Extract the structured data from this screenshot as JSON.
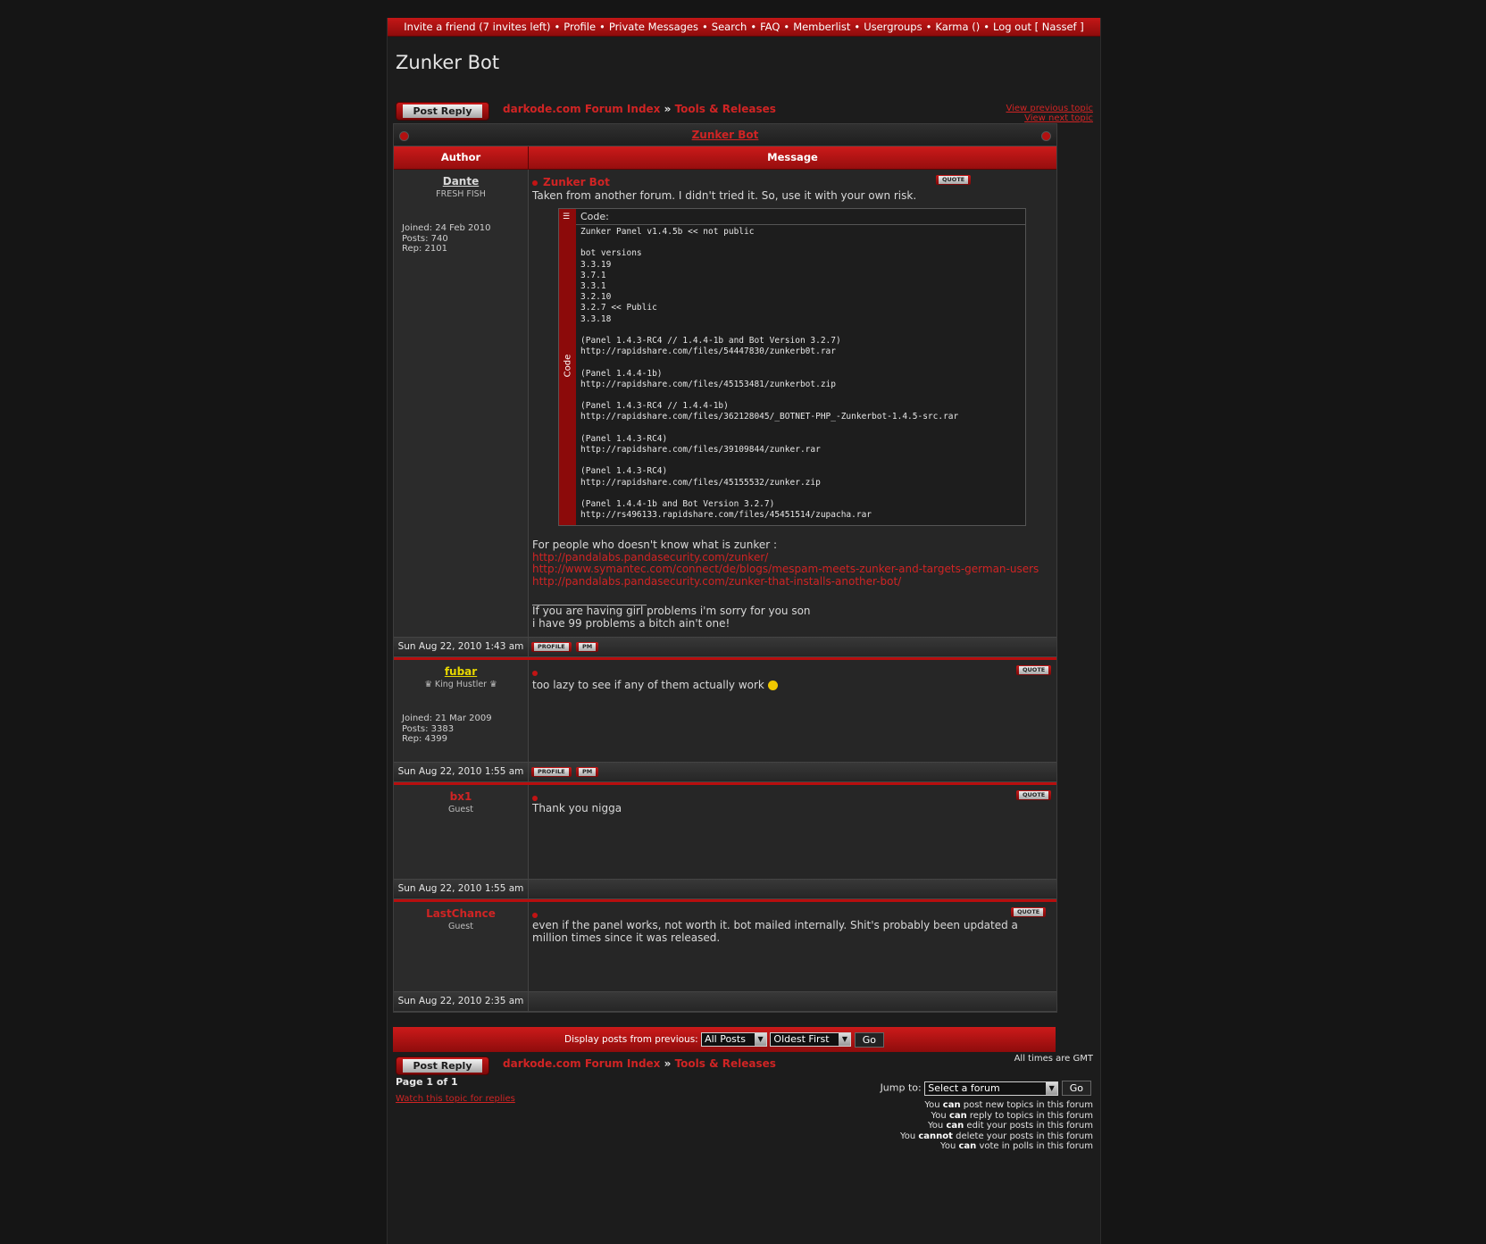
{
  "nav": {
    "items": [
      "Invite a friend (7 invites left)",
      "Profile",
      "Private Messages",
      "Search",
      "FAQ",
      "Memberlist",
      "Usergroups",
      "Karma ()",
      "Log out [ Nassef ]"
    ],
    "separator": "•"
  },
  "topic_title": "Zunker Bot",
  "post_reply_label": "Post Reply",
  "breadcrumb": {
    "forum_index": "darkode.com Forum Index",
    "sep": "»",
    "forum": "Tools & Releases"
  },
  "view_previous": "View previous topic",
  "view_next": "View next topic",
  "table_title": "Zunker Bot",
  "columns": {
    "author": "Author",
    "message": "Message"
  },
  "quote_label": "QUOTE",
  "profile_label": "PROFILE",
  "pm_label": "PM",
  "code_label": "Code:",
  "code_side_label": "Code",
  "posts": [
    {
      "author": "Dante",
      "rank": "FRESH FISH",
      "joined": "Joined: 24 Feb 2010",
      "posts": "Posts: 740",
      "rep": "Rep: 2101",
      "subject": "Zunker Bot",
      "intro": "Taken from another forum. I didn't tried it. So, use it with your own risk.",
      "code": "Zunker Panel v1.4.5b << not public\n\nbot versions\n3.3.19\n3.7.1\n3.3.1\n3.2.10\n3.2.7 << Public\n3.3.18\n\n(Panel 1.4.3-RC4 // 1.4.4-1b and Bot Version 3.2.7)\nhttp://rapidshare.com/files/54447830/zunkerb0t.rar\n\n(Panel 1.4.4-1b)\nhttp://rapidshare.com/files/45153481/zunkerbot.zip\n\n(Panel 1.4.3-RC4 // 1.4.4-1b)\nhttp://rapidshare.com/files/362128045/_BOTNET-PHP_-Zunkerbot-1.4.5-src.rar\n\n(Panel 1.4.3-RC4)\nhttp://rapidshare.com/files/39109844/zunker.rar\n\n(Panel 1.4.3-RC4)\nhttp://rapidshare.com/files/45155532/zunker.zip\n\n(Panel 1.4.4-1b and Bot Version 3.2.7)\nhttp://rs496133.rapidshare.com/files/45451514/zupacha.rar",
      "outro": "For people who doesn't know what is zunker :",
      "links": [
        "http://pandalabs.pandasecurity.com/zunker/",
        "http://www.symantec.com/connect/de/blogs/mespam-meets-zunker-and-targets-german-users",
        "http://pandalabs.pandasecurity.com/zunker-that-installs-another-bot/"
      ],
      "signature": [
        "If you are having girl problems i'm sorry for you son",
        "i have 99 problems a bitch ain't one!"
      ],
      "date": "Sun Aug 22, 2010 1:43 am"
    },
    {
      "author": "fubar",
      "rank": "♛ King Hustler ♛",
      "joined": "Joined: 21 Mar 2009",
      "posts": "Posts: 3383",
      "rep": "Rep: 4399",
      "text": "too lazy to see if any of them actually work",
      "date": "Sun Aug 22, 2010 1:55 am"
    },
    {
      "author": "bx1",
      "rank": "Guest",
      "text": "Thank you nigga",
      "date": "Sun Aug 22, 2010 1:55 am"
    },
    {
      "author": "LastChance",
      "rank": "Guest",
      "text": "even if the panel works, not worth it. bot mailed internally. Shit's probably been updated a million times since it was released.",
      "date": "Sun Aug 22, 2010 2:35 am"
    }
  ],
  "display_bar": {
    "label": "Display posts from previous:",
    "posts_select": "All Posts",
    "order_select": "Oldest First",
    "go": "Go"
  },
  "timezone": "All times are GMT",
  "page_info": "Page 1 of 1",
  "watch_topic": "Watch this topic for replies",
  "jump": {
    "label": "Jump to:",
    "select": "Select a forum",
    "go": "Go"
  },
  "permissions": [
    {
      "pre": "You ",
      "bold": "can",
      "post": " post new topics in this forum"
    },
    {
      "pre": "You ",
      "bold": "can",
      "post": " reply to topics in this forum"
    },
    {
      "pre": "You ",
      "bold": "can",
      "post": " edit your posts in this forum"
    },
    {
      "pre": "You ",
      "bold": "cannot",
      "post": " delete your posts in this forum"
    },
    {
      "pre": "You ",
      "bold": "can",
      "post": " vote in polls in this forum"
    }
  ],
  "colors": {
    "accent": "#c41717",
    "link": "#d02424",
    "fubar_name": "#e8d800"
  }
}
